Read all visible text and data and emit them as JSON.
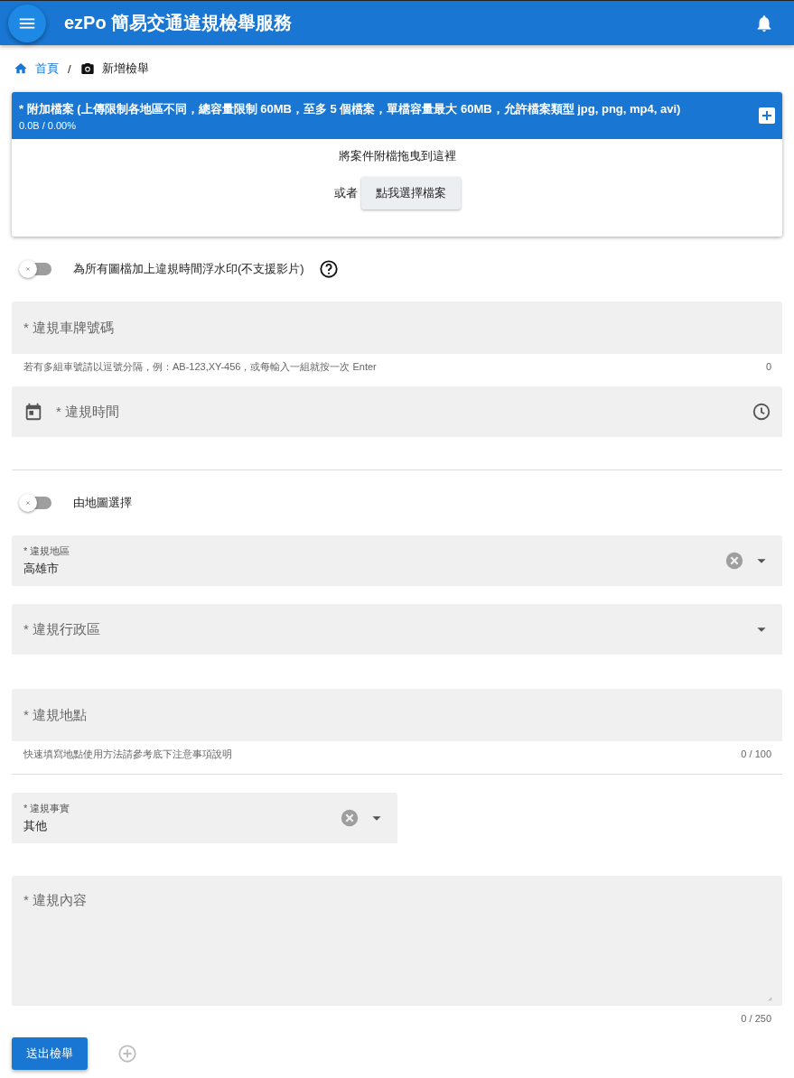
{
  "header": {
    "title": "ezPo 簡易交通違規檢舉服務"
  },
  "breadcrumb": {
    "separator": "/",
    "items": [
      {
        "label": "首頁",
        "kind": "home"
      },
      {
        "label": "新增檢舉",
        "kind": "camera"
      }
    ]
  },
  "upload": {
    "title": "* 附加檔案 (上傳限制各地區不同，總容量限制 60MB，至多 5 個檔案，單檔容量最大 60MB，允許檔案類型 jpg, png, mp4, avi)",
    "progress": "0.0B / 0.00%",
    "drop_text": "將案件附檔拖曳到這裡",
    "or_text": "或者",
    "button": "點我選擇檔案"
  },
  "form": [
    {
      "kind": "toggle",
      "label": "為所有圖檔加上違規時間浮水印(不支援影片)",
      "on": false,
      "help": true
    },
    {
      "kind": "text",
      "label": "* 違規車牌號碼",
      "hint": "若有多組車號請以逗號分隔，例：AB-123,XY-456，或每輸入一組就按一次 Enter",
      "counter": "0"
    },
    {
      "kind": "datetime",
      "label": "* 違規時間"
    },
    {
      "kind": "divider"
    },
    {
      "kind": "toggle",
      "label": "由地圖選擇",
      "on": false
    },
    {
      "kind": "select",
      "label": "* 違規地區",
      "value": "高雄市",
      "clearable": true
    },
    {
      "kind": "select",
      "label": "* 違規行政區"
    },
    {
      "kind": "text",
      "label": "* 違規地點",
      "hint": "快速填寫地點使用方法請參考底下注意事項說明",
      "counter": "0 / 100"
    },
    {
      "kind": "divider"
    },
    {
      "kind": "select",
      "label": "* 違規事實",
      "value": "其他",
      "clearable": true,
      "narrow": true
    },
    {
      "kind": "textarea",
      "label": "* 違規內容",
      "counter": "0 / 250"
    }
  ],
  "actions": {
    "submit": "送出檢舉"
  }
}
